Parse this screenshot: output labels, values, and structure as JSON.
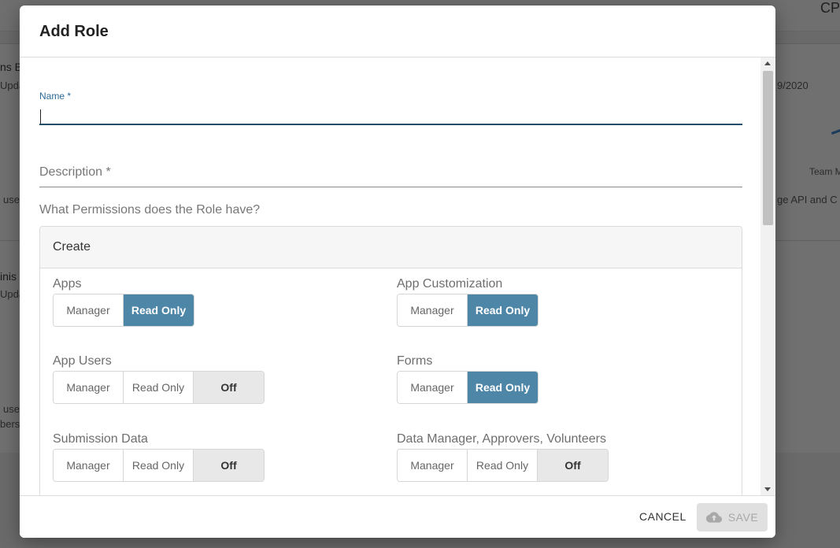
{
  "background": {
    "corner_text": "CP",
    "row1_title": "ns B",
    "row1_sub": "Upda",
    "row1_date": "9/2020",
    "row1_desc": "use",
    "row1_right_label": "Team M",
    "row1_right_desc": "ge API and C",
    "row2_title": "inis",
    "row2_sub": "Upda",
    "row2_desc1": "use",
    "row2_desc2": "bers"
  },
  "modal": {
    "title": "Add Role",
    "name_label": "Name *",
    "name_value": "",
    "description_label": "Description *",
    "permissions_question": "What Permissions does the Role have?",
    "panel_title": "Create",
    "permissions": [
      {
        "label": "Apps",
        "options": [
          "Manager",
          "Read Only"
        ],
        "selected": "Read Only"
      },
      {
        "label": "App Customization",
        "options": [
          "Manager",
          "Read Only"
        ],
        "selected": "Read Only"
      },
      {
        "label": "App Users",
        "options": [
          "Manager",
          "Read Only",
          "Off"
        ],
        "selected": "Off"
      },
      {
        "label": "Forms",
        "options": [
          "Manager",
          "Read Only"
        ],
        "selected": "Read Only"
      },
      {
        "label": "Submission Data",
        "options": [
          "Manager",
          "Read Only",
          "Off"
        ],
        "selected": "Off"
      },
      {
        "label": "Data Manager, Approvers, Volunteers",
        "options": [
          "Manager",
          "Read Only",
          "Off"
        ],
        "selected": "Off"
      }
    ],
    "cancel_label": "CANCEL",
    "save_label": "SAVE",
    "save_icon": "cloud-upload-icon"
  },
  "colors": {
    "accent": "#4e86a7",
    "input_focus": "#1f4e6b",
    "label_focus": "#2c6a96"
  }
}
